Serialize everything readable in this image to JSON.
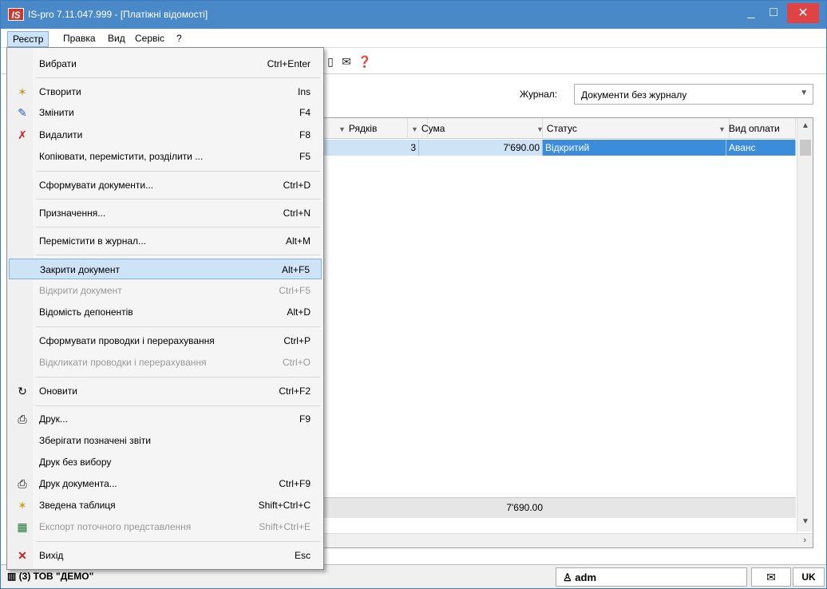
{
  "window": {
    "title": "IS-pro 7.11.047.999 - [Платіжні відомості]",
    "logo": "IS",
    "controls": {
      "minimize": "_",
      "maximize": "□",
      "close": "✕"
    }
  },
  "menubar": [
    {
      "label": "Реєстр",
      "active": true
    },
    {
      "label": "Правка"
    },
    {
      "label": "Вид"
    },
    {
      "label": "Сервіс"
    },
    {
      "label": "?"
    }
  ],
  "toolbar": {
    "icons": [
      "doc-icon",
      "mail-icon",
      "help-icon"
    ]
  },
  "journal": {
    "label": "Журнал:",
    "value": "Документи без журналу"
  },
  "grid": {
    "columns": [
      {
        "label": "Рядків"
      },
      {
        "label": "Сума"
      },
      {
        "label": "Статус"
      },
      {
        "label": "Вид оплати"
      }
    ],
    "rows": [
      {
        "rows_count": "3",
        "sum": "7'690.00",
        "status": "Відкритий",
        "payment_type": "Аванс"
      }
    ],
    "totals": {
      "sum": "7'690.00"
    }
  },
  "status": {
    "org": "(3) ТОВ \"ДЕМО\"",
    "user": "adm",
    "lang": "UK"
  },
  "menu": {
    "items": [
      {
        "label": "Вибрати",
        "shortcut": "Ctrl+Enter",
        "icon": ""
      },
      {
        "label": "Створити",
        "shortcut": "Ins",
        "icon": "new-doc-icon"
      },
      {
        "label": "Змінити",
        "shortcut": "F4",
        "icon": "edit-doc-icon"
      },
      {
        "label": "Видалити",
        "shortcut": "F8",
        "icon": "delete-doc-icon"
      },
      {
        "label": "Копіювати, перемістити, розділити ...",
        "shortcut": "F5",
        "icon": ""
      },
      {
        "label": "Сформувати документи...",
        "shortcut": "Ctrl+D",
        "icon": ""
      },
      {
        "label": "Призначення...",
        "shortcut": "Ctrl+N",
        "icon": ""
      },
      {
        "label": "Перемістити в журнал...",
        "shortcut": "Alt+M",
        "icon": ""
      },
      {
        "label": "Закрити документ",
        "shortcut": "Alt+F5",
        "icon": ""
      },
      {
        "label": "Відкрити документ",
        "shortcut": "Ctrl+F5",
        "icon": ""
      },
      {
        "label": "Відомість депонентів",
        "shortcut": "Alt+D",
        "icon": ""
      },
      {
        "label": "Сформувати проводки і перерахування",
        "shortcut": "Ctrl+P",
        "icon": ""
      },
      {
        "label": "Відкликати проводки і перерахування",
        "shortcut": "Ctrl+O",
        "icon": ""
      },
      {
        "label": "Оновити",
        "shortcut": "Ctrl+F2",
        "icon": "refresh-icon"
      },
      {
        "label": "Друк...",
        "shortcut": "F9",
        "icon": "printer-icon"
      },
      {
        "label": "Зберігати позначені звіти",
        "shortcut": "",
        "icon": ""
      },
      {
        "label": "Друк без вибору",
        "shortcut": "",
        "icon": ""
      },
      {
        "label": "Друк документа...",
        "shortcut": "Ctrl+F9",
        "icon": "print-doc-icon"
      },
      {
        "label": "Зведена таблиця",
        "shortcut": "Shift+Ctrl+C",
        "icon": "pivot-icon"
      },
      {
        "label": "Експорт поточного представлення",
        "shortcut": "Shift+Ctrl+E",
        "icon": "excel-icon"
      },
      {
        "label": "Вихід",
        "shortcut": "Esc",
        "icon": "exit-icon"
      }
    ]
  }
}
